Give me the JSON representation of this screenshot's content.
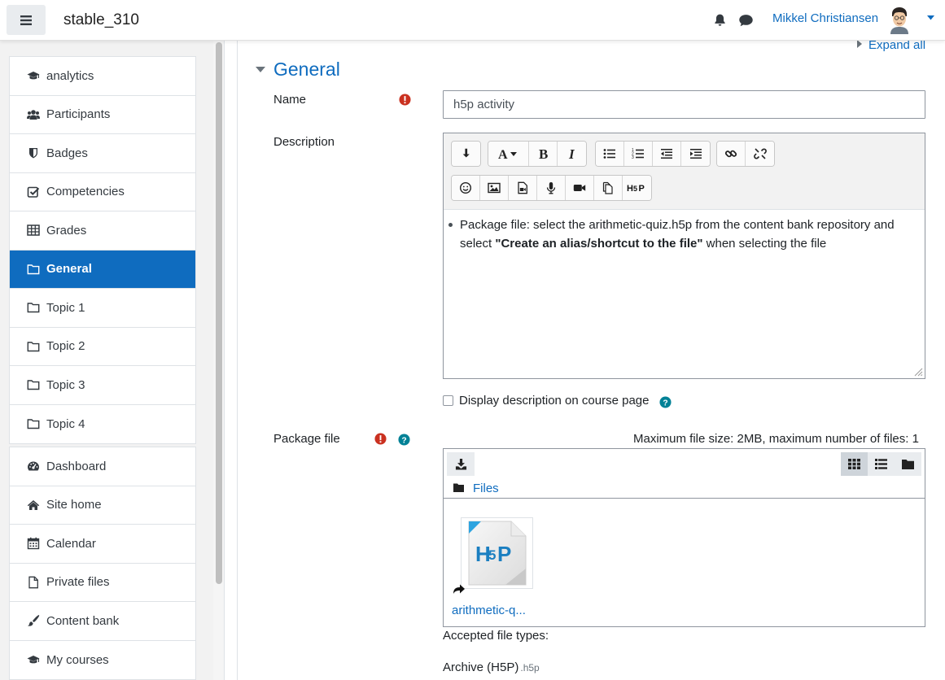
{
  "navbar": {
    "site_name": "stable_310",
    "user_name": "Mikkel Christiansen",
    "icons": {
      "menu": "hamburger-icon",
      "notifications": "bell-icon",
      "messages": "chat-icon",
      "user_menu": "caret-down-icon"
    }
  },
  "drawer": {
    "course_items": [
      {
        "label": "analytics",
        "icon": "graduation-cap-icon"
      },
      {
        "label": "Participants",
        "icon": "users-icon"
      },
      {
        "label": "Badges",
        "icon": "shield-icon"
      },
      {
        "label": "Competencies",
        "icon": "check-square-icon"
      },
      {
        "label": "Grades",
        "icon": "table-icon"
      },
      {
        "label": "General",
        "icon": "folder-icon",
        "active": true
      },
      {
        "label": "Topic 1",
        "icon": "folder-icon"
      },
      {
        "label": "Topic 2",
        "icon": "folder-icon"
      },
      {
        "label": "Topic 3",
        "icon": "folder-icon"
      },
      {
        "label": "Topic 4",
        "icon": "folder-icon"
      }
    ],
    "site_items": [
      {
        "label": "Dashboard",
        "icon": "tachometer-icon"
      },
      {
        "label": "Site home",
        "icon": "home-icon"
      },
      {
        "label": "Calendar",
        "icon": "calendar-icon"
      },
      {
        "label": "Private files",
        "icon": "file-icon"
      },
      {
        "label": "Content bank",
        "icon": "paintbrush-icon"
      },
      {
        "label": "My courses",
        "icon": "graduation-cap-icon"
      }
    ]
  },
  "form": {
    "expand_all": "Expand all",
    "section_title": "General",
    "name_label": "Name",
    "name_value": "h5p activity",
    "description_label": "Description",
    "description": {
      "text_before": "Package file: select the arithmetic-quiz.h5p from the content bank repository and select ",
      "text_bold": "\"Create an alias/shortcut to the file\"",
      "text_after": " when selecting the file"
    },
    "display_description_label": "Display description on course page",
    "display_description_checked": false,
    "package_file_label": "Package file",
    "file_limits": "Maximum file size: 2MB, maximum number of files: 1",
    "files_path": "Files",
    "file_name": "arithmetic-q...",
    "file_icon": "h5p-file-icon",
    "accepted_label": "Accepted file types:",
    "accepted_type": "Archive (H5P)",
    "accepted_ext": ".h5p"
  },
  "editor_toolbar": {
    "row1": [
      "collapse-icon",
      "font-color-icon",
      "bold-icon",
      "italic-icon",
      "unordered-list-icon",
      "ordered-list-icon",
      "outdent-icon",
      "indent-icon",
      "link-icon",
      "unlink-icon"
    ],
    "row2": [
      "emoticon-icon",
      "image-icon",
      "media-icon",
      "record-audio-icon",
      "record-video-icon",
      "manage-files-icon",
      "h5p-icon"
    ]
  },
  "colors": {
    "brand": "#0f6cbf",
    "required": "#ca3120",
    "help": "#008196"
  }
}
